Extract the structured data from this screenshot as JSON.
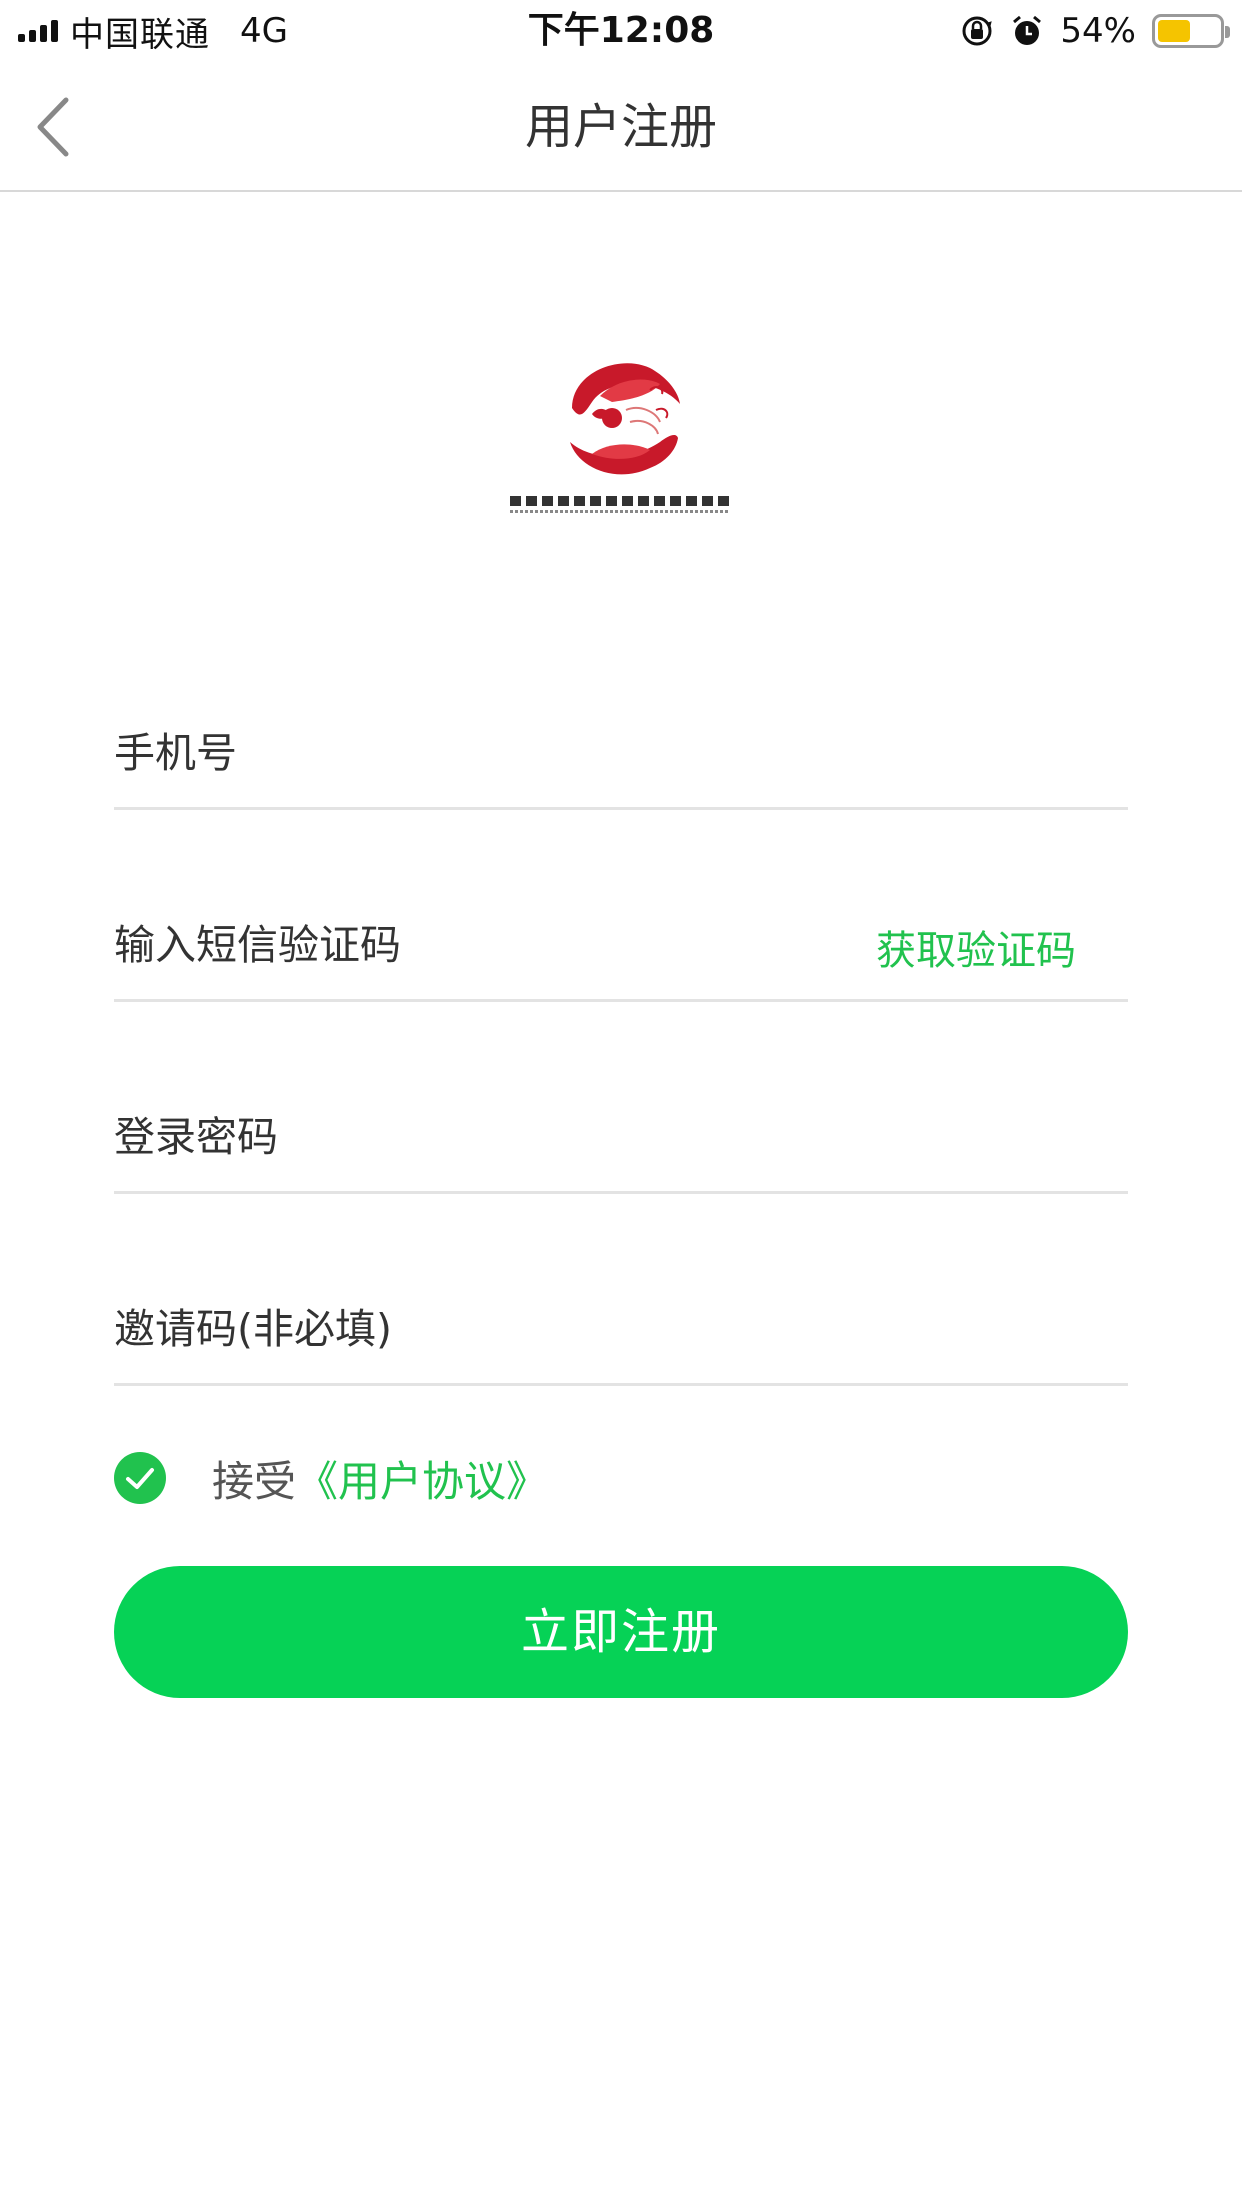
{
  "status_bar": {
    "carrier": "中国联通",
    "network": "4G",
    "time": "下午12:08",
    "battery_percent": "54%",
    "battery_level": 0.54,
    "icons": [
      "signal-icon",
      "rotation-lock-icon",
      "alarm-icon",
      "battery-icon"
    ]
  },
  "nav": {
    "title": "用户注册",
    "back_icon": "chevron-left-icon"
  },
  "logo": {
    "company_name": "郑州市天明中医茶发展有限公司",
    "company_name_en": "ZHENGZHOU TIANMING TRADITIONAL CHINESE MEDICINE DEVELOPMENT CO., LTD."
  },
  "form": {
    "phone_placeholder": "手机号",
    "sms_code_placeholder": "输入短信验证码",
    "get_code_label": "获取验证码",
    "password_placeholder": "登录密码",
    "invite_placeholder": "邀请码(非必填)"
  },
  "agreement": {
    "checked": true,
    "prefix": "接受",
    "link": "《用户协议》"
  },
  "submit": {
    "label": "立即注册"
  },
  "colors": {
    "accent": "#06d256",
    "link": "#21c24e",
    "logo_red": "#c8192a"
  }
}
